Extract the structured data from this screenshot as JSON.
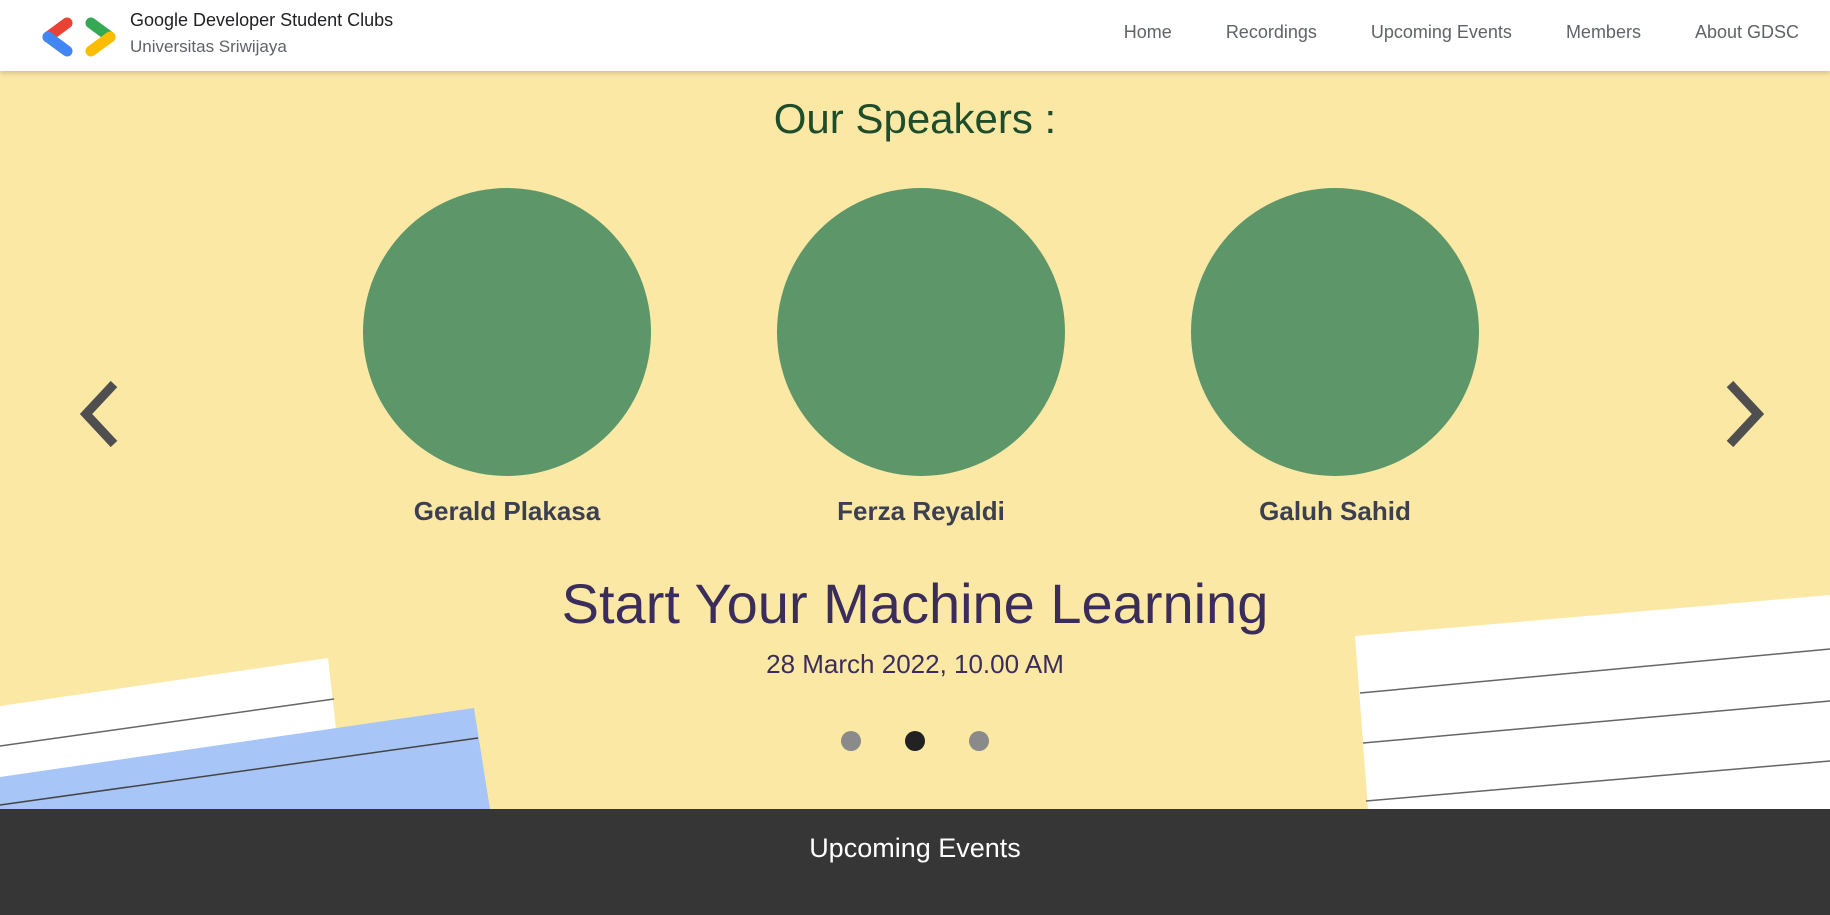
{
  "header": {
    "brand_name": "Google Developer Student Clubs",
    "brand_sub": "Universitas Sriwijaya",
    "logo_icon": "gdsc-brackets-logo",
    "nav": [
      {
        "label": "Home"
      },
      {
        "label": "Recordings"
      },
      {
        "label": "Upcoming Events"
      },
      {
        "label": "Members"
      },
      {
        "label": "About GDSC"
      }
    ]
  },
  "hero": {
    "title": "Our Speakers :",
    "speakers": [
      {
        "name": "Gerald Plakasa"
      },
      {
        "name": "Ferza Reyaldi"
      },
      {
        "name": "Galuh Sahid"
      }
    ],
    "event_title": "Start Your Machine Learning",
    "event_date": "28 March 2022, 10.00 AM",
    "prev_icon": "chevron-left-icon",
    "next_icon": "chevron-right-icon",
    "slide_count": 3,
    "active_slide": 2
  },
  "section_bar": {
    "title": "Upcoming Events"
  },
  "colors": {
    "hero_bg": "#fce8a5",
    "speaker_placeholder": "#5d9668",
    "section_bar_bg": "#363636",
    "title_green": "#1e4d2b",
    "event_purple": "#3a2d5c",
    "google_blue": "#4285f4",
    "google_red": "#ea4335",
    "google_green": "#34a853",
    "google_yellow": "#fbbc04"
  }
}
